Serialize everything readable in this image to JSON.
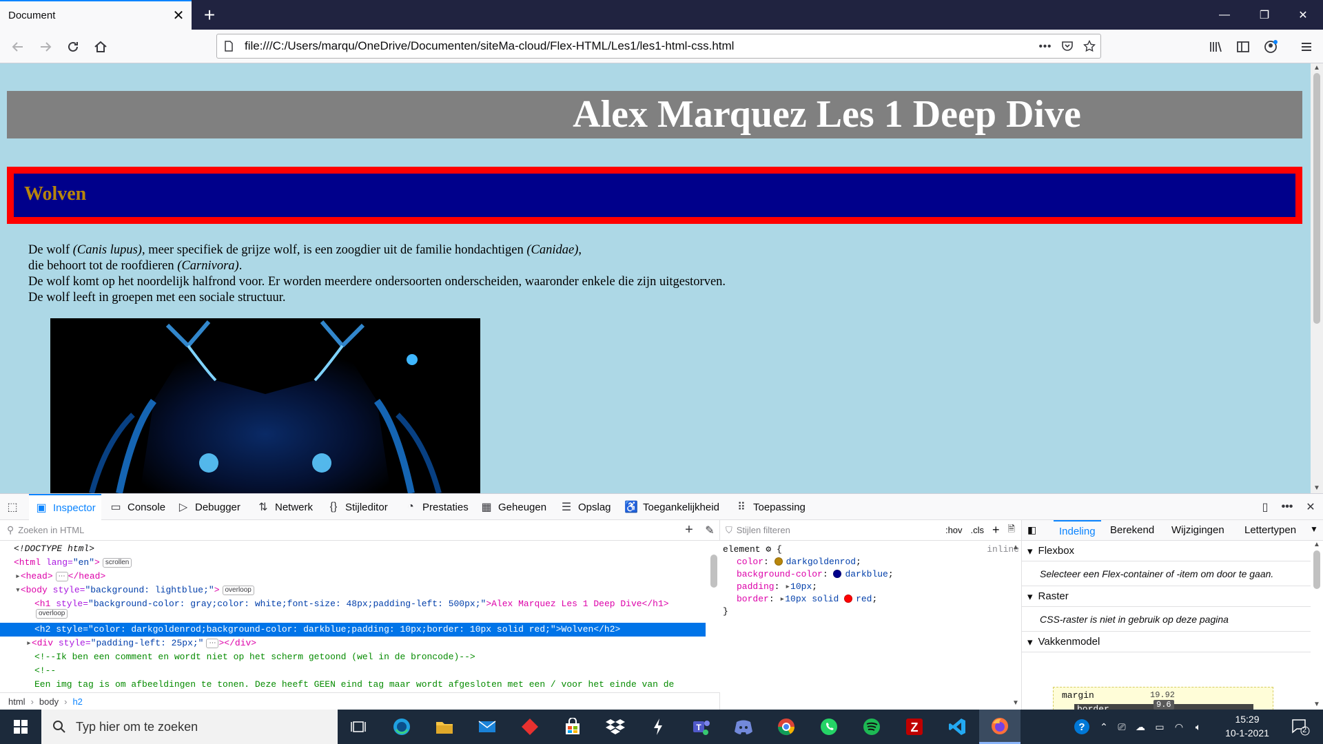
{
  "browser": {
    "tab_title": "Document",
    "url": "file:///C:/Users/marqu/OneDrive/Documenten/siteMa-cloud/Flex-HTML/Les1/les1-html-css.html"
  },
  "page": {
    "h1": "Alex Marquez Les 1 Deep Dive",
    "h2": "Wolven",
    "para": {
      "l1a": "De wolf ",
      "l1b": "(Canis lupus)",
      "l1c": ", meer specifiek de grijze wolf, is een zoogdier uit de familie hondachtigen ",
      "l1d": "(Canidae)",
      "l1e": ",",
      "l2a": "die behoort tot de roofdieren ",
      "l2b": "(Carnivora)",
      "l2c": ".",
      "l3": "De wolf komt op het noordelijk halfrond voor. Er worden meerdere ondersoorten onderscheiden, waaronder enkele die zijn uitgestorven.",
      "l4": "De wolf leeft in groepen met een sociale structuur."
    },
    "colors": {
      "background": "#add8e6",
      "h1_bg": "#808080",
      "h2_color": "#b8860b",
      "h2_bg": "#00008b",
      "h2_border": "#ff0000"
    }
  },
  "devtools": {
    "tabs": [
      "Inspector",
      "Console",
      "Debugger",
      "Netwerk",
      "Stijleditor",
      "Prestaties",
      "Geheugen",
      "Opslag",
      "Toegankelijkheid",
      "Toepassing"
    ],
    "html_search_placeholder": "Zoeken in HTML",
    "markup": {
      "doctype": "<!DOCTYPE html>",
      "html_open_tag": "<html",
      "html_attr": " lang=",
      "html_attr_val": "\"en\"",
      "html_close": ">",
      "html_badge": "scrollen",
      "head": "<head>",
      "head_close": "</head>",
      "body_tag": "<body",
      "body_attr": " style=",
      "body_val": "\"background: lightblue;\"",
      "body_close": ">",
      "body_badge": "overloop",
      "h1_tag": "<h1",
      "h1_attr": " style=",
      "h1_val": "\"background-color: gray;color: white;font-size: 48px;padding-left: 500px;\"",
      "h1_text": ">Alex Marquez Les 1 Deep Dive</h1>",
      "h1_badge": "overloop",
      "h2_line": "<h2 style=\"color: darkgoldenrod;background-color: darkblue;padding: 10px;border: 10px solid red;\">Wolven</h2>",
      "div_tag": "<div",
      "div_attr": " style=",
      "div_val": "\"padding-left: 25px;\"",
      "div_close": "></div>",
      "comment1": "<!--Ik ben een comment en wordt niet op het scherm getoond (wel in de broncode)-->",
      "comment2": "<!--",
      "comment3": "Een img tag is om afbeeldingen te tonen. Deze heeft GEEN eind tag maar wordt afgesloten met een / voor het einde van de"
    },
    "breadcrumbs": [
      "html",
      "body",
      "h2"
    ],
    "styles": {
      "filter_placeholder": "Stijlen filteren",
      "hov": ":hov",
      "cls": ".cls",
      "selector": "element",
      "inline": "inline",
      "props": [
        {
          "name": "color",
          "value": "darkgoldenrod",
          "swatch": "#b8860b"
        },
        {
          "name": "background-color",
          "value": "darkblue",
          "swatch": "#00008b"
        },
        {
          "name": "padding",
          "value": "10px",
          "swatch": ""
        },
        {
          "name": "border",
          "value": "10px solid",
          "value2": "red",
          "swatch": "#ff0000"
        }
      ]
    },
    "layout": {
      "tabs": [
        "Indeling",
        "Berekend",
        "Wijzigingen",
        "Lettertypen"
      ],
      "flexbox_h": "Flexbox",
      "flexbox_b": "Selecteer een Flex-container of -item om door te gaan.",
      "raster_h": "Raster",
      "raster_b": "CSS-raster is niet in gebruik op deze pagina",
      "boxmodel_h": "Vakkenmodel",
      "margin_label": "margin",
      "margin_val": "19.92",
      "border_label": "border",
      "border_val": "9.6"
    }
  },
  "taskbar": {
    "search_placeholder": "Typ hier om te zoeken",
    "time": "15:29",
    "date": "10-1-2021",
    "notif_count": "2"
  }
}
